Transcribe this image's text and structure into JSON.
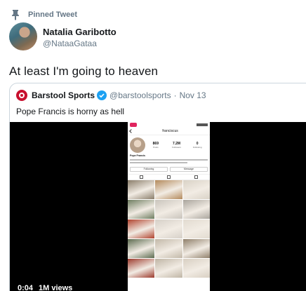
{
  "pinned": {
    "label": "Pinned Tweet"
  },
  "author": {
    "name": "Natalia Garibotto",
    "handle": "@NataaGataa"
  },
  "tweet": {
    "text": "At least I'm going to heaven"
  },
  "quoted": {
    "name": "Barstool Sports",
    "handle": "@barstoolsports",
    "separator": "·",
    "date": "Nov 13",
    "text": "Pope Francis is horny as hell"
  },
  "video": {
    "time": "0:04",
    "views": "1M views"
  },
  "phone": {
    "username": "franciscus",
    "stats": [
      {
        "num": "869",
        "label": "Posts"
      },
      {
        "num": "7.2M",
        "label": "Followers"
      },
      {
        "num": "0",
        "label": "Following"
      }
    ],
    "bio_name": "Pope Francis",
    "buttons": [
      "Following",
      "Message"
    ],
    "grid_colors": [
      "#8a7d6a",
      "#b48a5c",
      "#d9d2c6",
      "#6e7d60",
      "#c9c4bc",
      "#a9a49c",
      "#b1432e",
      "#d6d0c8",
      "#e2dbd0",
      "#5c6b4f",
      "#c2b8a8",
      "#8f7f6a",
      "#9c3a2c",
      "#bfb5a5",
      "#d8cfc2"
    ]
  },
  "colors": {
    "accent": "#1da1f2",
    "secondary_text": "#657786",
    "border": "#ccd6dd"
  }
}
